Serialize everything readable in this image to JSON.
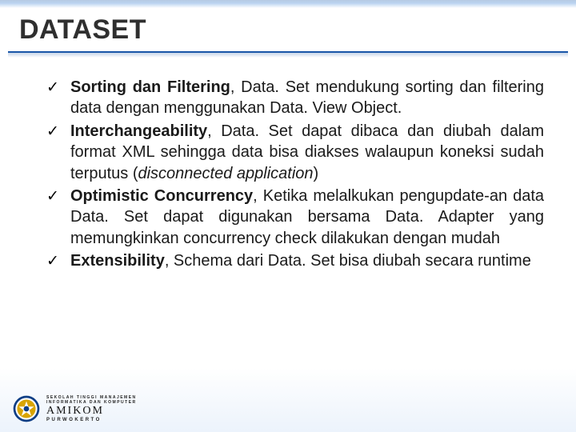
{
  "title": "DATASET",
  "bullets": [
    {
      "label": "Sorting dan Filtering",
      "rest": ", Data. Set mendukung sorting dan filtering data dengan menggunakan Data. View Object."
    },
    {
      "label": "Interchangeability",
      "rest_a": ", Data. Set dapat dibaca dan diubah dalam format XML sehingga data bisa diakses walaupun koneksi sudah terputus (",
      "italic": "disconnected application",
      "rest_b": ")"
    },
    {
      "label": "Optimistic Concurrency",
      "rest": ", Ketika melalkukan pengupdate-an data Data. Set dapat digunakan bersama Data. Adapter yang memungkinkan concurrency check dilakukan dengan mudah"
    },
    {
      "label": "Extensibility",
      "rest": ", Schema dari Data. Set bisa diubah secara runtime"
    }
  ],
  "footer": {
    "line1": "SEKOLAH TINGGI MANAJEMEN",
    "line2": "INFORMATIKA DAN KOMPUTER",
    "brand": "AMIKOM",
    "city": "PURWOKERTO"
  }
}
